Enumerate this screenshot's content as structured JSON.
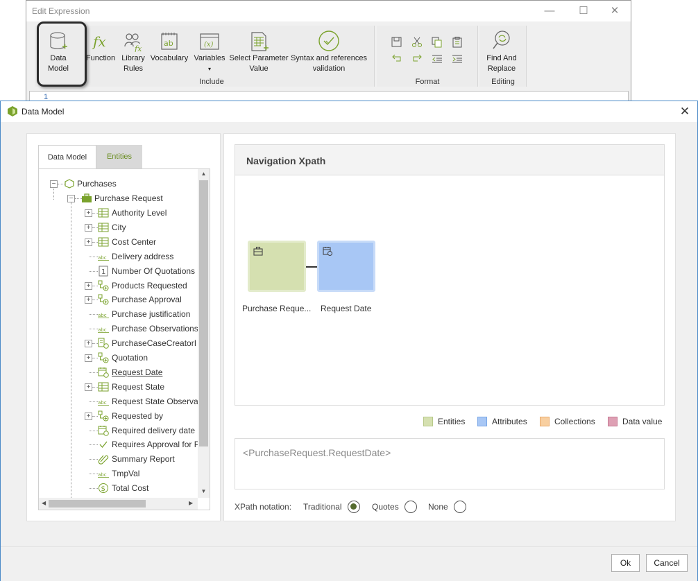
{
  "edit_window": {
    "title": "Edit Expression",
    "ribbon": {
      "data_model": [
        "Data",
        "Model"
      ],
      "function": "Function",
      "library_rules": [
        "Library",
        "Rules"
      ],
      "vocabulary": "Vocabulary",
      "variables": "Variables",
      "variables_caret": "▾",
      "select_parameter": [
        "Select Parameter",
        "Value"
      ],
      "syntax_validation": [
        "Syntax and references",
        "validation"
      ],
      "find_replace": [
        "Find And",
        "Replace"
      ],
      "group_include": "Include",
      "group_format": "Format",
      "group_editing": "Editing"
    },
    "line_number": "1"
  },
  "dialog": {
    "title": "Data Model",
    "tabs": [
      "Data Model",
      "Entities"
    ],
    "tree": {
      "root": "Purchases",
      "entity": "Purchase Request",
      "items": [
        {
          "label": "Authority Level",
          "icon": "table-icon",
          "expandable": true
        },
        {
          "label": "City",
          "icon": "table-icon",
          "expandable": true
        },
        {
          "label": "Cost Center",
          "icon": "table-icon",
          "expandable": true
        },
        {
          "label": "Delivery address",
          "icon": "abc-icon",
          "expandable": false
        },
        {
          "label": "Number Of Quotations",
          "icon": "number-icon",
          "expandable": false
        },
        {
          "label": "Products Requested",
          "icon": "collection-icon",
          "expandable": true
        },
        {
          "label": "Purchase Approval",
          "icon": "collection-icon",
          "expandable": true
        },
        {
          "label": "Purchase justification",
          "icon": "abc-icon",
          "expandable": false
        },
        {
          "label": "Purchase Observations",
          "icon": "abc-icon",
          "expandable": false
        },
        {
          "label": "PurchaseCaseCreatorI",
          "icon": "doc-collection-icon",
          "expandable": true
        },
        {
          "label": "Quotation",
          "icon": "collection-icon",
          "expandable": true
        },
        {
          "label": "Request Date",
          "icon": "calendar-icon",
          "expandable": false,
          "selected": true
        },
        {
          "label": "Request State",
          "icon": "table-icon",
          "expandable": true
        },
        {
          "label": "Request State Observa",
          "icon": "abc-icon",
          "expandable": false
        },
        {
          "label": "Requested by",
          "icon": "collection-icon",
          "expandable": true
        },
        {
          "label": "Required delivery date",
          "icon": "calendar-icon",
          "expandable": false
        },
        {
          "label": "Requires Approval for P",
          "icon": "check-icon",
          "expandable": false
        },
        {
          "label": "Summary Report",
          "icon": "paperclip-icon",
          "expandable": false
        },
        {
          "label": "TmpVal",
          "icon": "abc-icon",
          "expandable": false
        },
        {
          "label": "Total Cost",
          "icon": "currency-icon",
          "expandable": false
        }
      ]
    },
    "nav": {
      "title": "Navigation Xpath",
      "node_entity": "Purchase Reque...",
      "node_attribute": "Request Date"
    },
    "legend": [
      {
        "label": "Entities",
        "fill": "#d5e0b0",
        "stroke": "#b8c98a"
      },
      {
        "label": "Attributes",
        "fill": "#a8c7f5",
        "stroke": "#7aa7e6"
      },
      {
        "label": "Collections",
        "fill": "#f8cfa0",
        "stroke": "#e8a868"
      },
      {
        "label": "Data value",
        "fill": "#dea0b4",
        "stroke": "#c47892"
      }
    ],
    "xpath": "<PurchaseRequest.RequestDate>",
    "notation": {
      "label": "XPath notation:",
      "options": [
        "Traditional",
        "Quotes",
        "None"
      ],
      "selected": "Traditional"
    },
    "buttons": {
      "ok": "Ok",
      "cancel": "Cancel"
    },
    "colors": {
      "accent_green": "#7aa22c",
      "entity_node": "#d5e0b0",
      "attribute_node": "#a8c7f5"
    }
  }
}
